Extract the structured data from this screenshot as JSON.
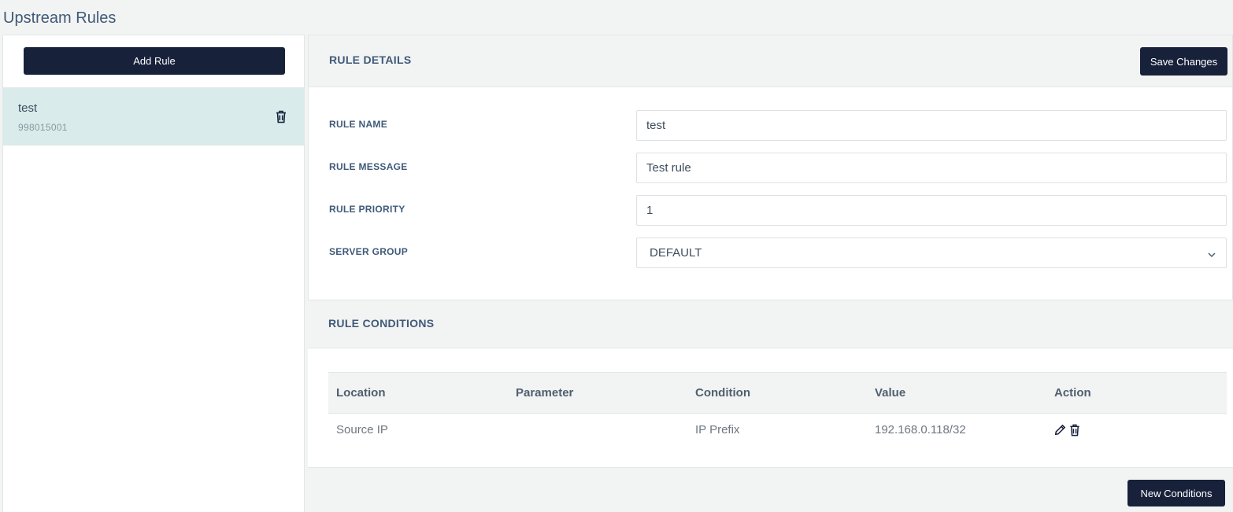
{
  "page": {
    "title": "Upstream Rules"
  },
  "sidebar": {
    "add_rule_label": "Add Rule",
    "rules": [
      {
        "name": "test",
        "id": "998015001"
      }
    ]
  },
  "details": {
    "title": "RULE DETAILS",
    "save_label": "Save Changes",
    "fields": {
      "name": {
        "label": "RULE NAME",
        "value": "test"
      },
      "message": {
        "label": "RULE MESSAGE",
        "value": "Test rule"
      },
      "priority": {
        "label": "RULE PRIORITY",
        "value": "1"
      },
      "server_group": {
        "label": "SERVER GROUP",
        "value": "DEFAULT"
      }
    }
  },
  "conditions": {
    "title": "RULE CONDITIONS",
    "columns": [
      "Location",
      "Parameter",
      "Condition",
      "Value",
      "Action"
    ],
    "rows": [
      {
        "location": "Source IP",
        "parameter": "",
        "condition": "IP Prefix",
        "value": "192.168.0.118/32"
      }
    ],
    "new_label": "New Conditions"
  },
  "colors": {
    "accent": "#17213a",
    "selected_row": "#d9eceb",
    "heading": "#3f5a78"
  },
  "icons": [
    "trash-icon",
    "pencil-icon",
    "chevron-down-icon"
  ]
}
